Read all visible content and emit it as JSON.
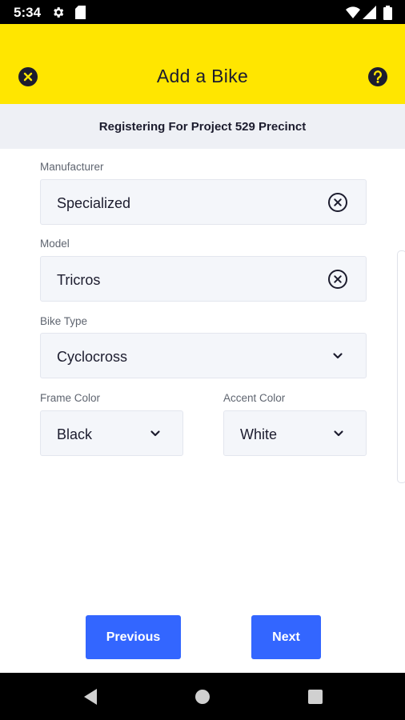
{
  "status_bar": {
    "time": "5:34",
    "icons": [
      "gear-icon",
      "sd-card-icon",
      "wifi-icon",
      "signal-icon",
      "battery-icon"
    ]
  },
  "app_bar": {
    "title": "Add a Bike",
    "left_icon": "close-icon",
    "right_icon": "help-icon",
    "background": "#FFE600"
  },
  "banner": {
    "text": "Registering For Project 529 Precinct"
  },
  "form": {
    "manufacturer": {
      "label": "Manufacturer",
      "value": "Specialized",
      "icon": "clear-icon"
    },
    "model": {
      "label": "Model",
      "value": "Tricros",
      "icon": "clear-icon"
    },
    "bike_type": {
      "label": "Bike Type",
      "value": "Cyclocross",
      "icon": "chevron-down-icon"
    },
    "frame_color": {
      "label": "Frame Color",
      "value": "Black",
      "icon": "chevron-down-icon"
    },
    "accent_color": {
      "label": "Accent Color",
      "value": "White",
      "icon": "chevron-down-icon"
    }
  },
  "actions": {
    "previous_label": "Previous",
    "next_label": "Next",
    "button_color": "#3366FF"
  },
  "nav_bar": {
    "icons": [
      "back-icon",
      "home-icon",
      "recents-icon"
    ]
  }
}
